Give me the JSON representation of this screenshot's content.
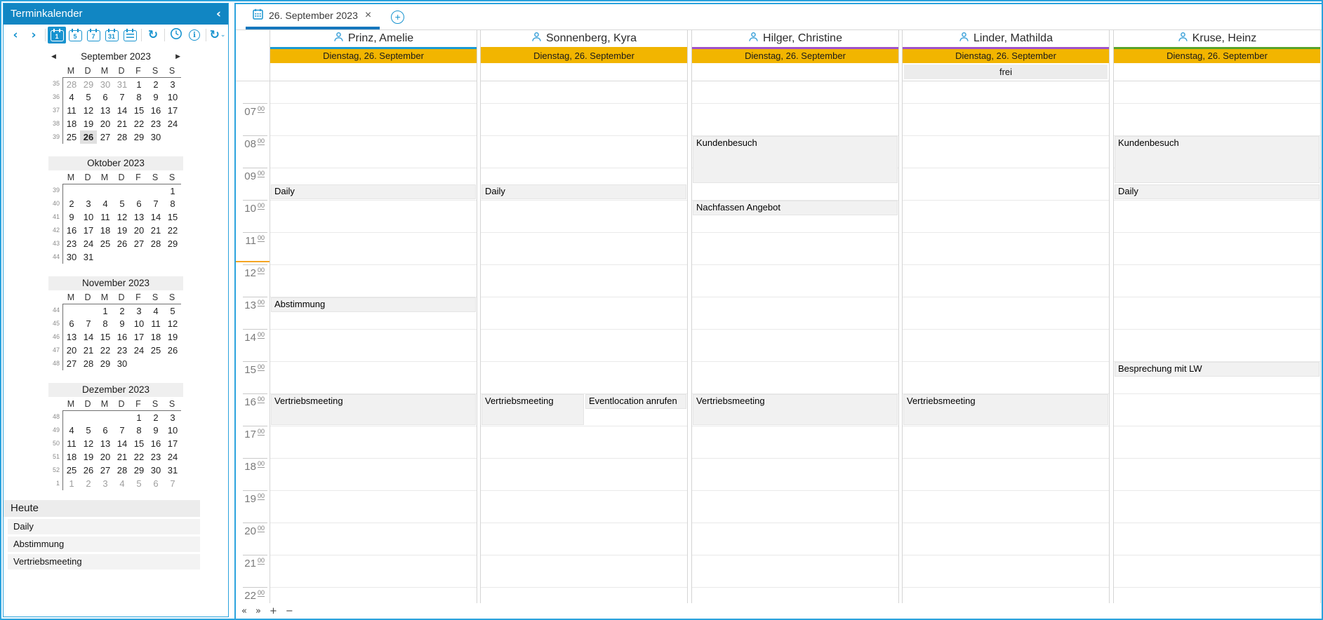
{
  "colors": {
    "accent_blue": "#1793cf",
    "titlebar_blue": "#1186c3",
    "panel_border_blue": "#2ba3dd",
    "date_bar_amber": "#f2b500",
    "current_time_line": "#f5a623",
    "event_fill": "#f1f1f1"
  },
  "sidebar": {
    "title": "Terminkalender",
    "collapse_glyph": "‹",
    "nav_prev_glyph": "◀",
    "nav_next_glyph": "▶",
    "week_day_headers": [
      "M",
      "D",
      "M",
      "D",
      "F",
      "S",
      "S"
    ],
    "toolbar": [
      {
        "name": "prev-period",
        "glyph": "‹"
      },
      {
        "name": "next-period",
        "glyph": "›"
      },
      {
        "type": "sep"
      },
      {
        "type": "cal",
        "name": "day-view",
        "label": "1",
        "selected": true
      },
      {
        "type": "cal",
        "name": "workweek-view",
        "label": "5"
      },
      {
        "type": "cal",
        "name": "week-view",
        "label": "7"
      },
      {
        "type": "cal",
        "name": "month-view",
        "label": "31"
      },
      {
        "type": "agenda",
        "name": "agenda-view"
      },
      {
        "type": "sep"
      },
      {
        "name": "refresh",
        "glyph": "↻"
      },
      {
        "type": "sep"
      },
      {
        "type": "clock",
        "name": "time-scale"
      },
      {
        "type": "info",
        "name": "info"
      },
      {
        "type": "sep"
      },
      {
        "name": "sync",
        "glyph": "↻",
        "dropdown": "⌄"
      }
    ],
    "months": [
      {
        "title": "September 2023",
        "nav": true,
        "gray": false,
        "weeks": [
          {
            "n": "35",
            "days": [
              "28m",
              "29m",
              "30m",
              "31m",
              "1",
              "2",
              "3"
            ]
          },
          {
            "n": "36",
            "days": [
              "4",
              "5",
              "6",
              "7",
              "8",
              "9",
              "10"
            ]
          },
          {
            "n": "37",
            "days": [
              "11",
              "12",
              "13",
              "14",
              "15",
              "16",
              "17"
            ]
          },
          {
            "n": "38",
            "days": [
              "18",
              "19",
              "20",
              "21",
              "22",
              "23",
              "24"
            ]
          },
          {
            "n": "39",
            "days": [
              "25",
              "26s",
              "27",
              "28",
              "29",
              "30",
              ""
            ]
          }
        ]
      },
      {
        "title": "Oktober 2023",
        "nav": false,
        "gray": true,
        "weeks": [
          {
            "n": "39",
            "days": [
              "",
              "",
              "",
              "",
              "",
              "",
              "1"
            ]
          },
          {
            "n": "40",
            "days": [
              "2",
              "3",
              "4",
              "5",
              "6",
              "7",
              "8"
            ]
          },
          {
            "n": "41",
            "days": [
              "9",
              "10",
              "11",
              "12",
              "13",
              "14",
              "15"
            ]
          },
          {
            "n": "42",
            "days": [
              "16",
              "17",
              "18",
              "19",
              "20",
              "21",
              "22"
            ]
          },
          {
            "n": "43",
            "days": [
              "23",
              "24",
              "25",
              "26",
              "27",
              "28",
              "29"
            ]
          },
          {
            "n": "44",
            "days": [
              "30",
              "31",
              "",
              "",
              "",
              "",
              ""
            ]
          }
        ]
      },
      {
        "title": "November 2023",
        "nav": false,
        "gray": true,
        "weeks": [
          {
            "n": "44",
            "days": [
              "",
              "",
              "1",
              "2",
              "3",
              "4",
              "5"
            ]
          },
          {
            "n": "45",
            "days": [
              "6",
              "7",
              "8",
              "9",
              "10",
              "11",
              "12"
            ]
          },
          {
            "n": "46",
            "days": [
              "13",
              "14",
              "15",
              "16",
              "17",
              "18",
              "19"
            ]
          },
          {
            "n": "47",
            "days": [
              "20",
              "21",
              "22",
              "23",
              "24",
              "25",
              "26"
            ]
          },
          {
            "n": "48",
            "days": [
              "27",
              "28",
              "29",
              "30",
              "",
              "",
              ""
            ]
          }
        ]
      },
      {
        "title": "Dezember 2023",
        "nav": false,
        "gray": true,
        "weeks": [
          {
            "n": "48",
            "days": [
              "",
              "",
              "",
              "",
              "1",
              "2",
              "3"
            ]
          },
          {
            "n": "49",
            "days": [
              "4",
              "5",
              "6",
              "7",
              "8",
              "9",
              "10"
            ]
          },
          {
            "n": "50",
            "days": [
              "11",
              "12",
              "13",
              "14",
              "15",
              "16",
              "17"
            ]
          },
          {
            "n": "51",
            "days": [
              "18",
              "19",
              "20",
              "21",
              "22",
              "23",
              "24"
            ]
          },
          {
            "n": "52",
            "days": [
              "25",
              "26",
              "27",
              "28",
              "29",
              "30",
              "31"
            ]
          },
          {
            "n": "1",
            "days": [
              "1m",
              "2m",
              "3m",
              "4m",
              "5m",
              "6m",
              "7m"
            ]
          }
        ]
      }
    ],
    "today": {
      "header": "Heute",
      "items": [
        "Daily",
        "Abstimmung",
        "Vertriebsmeeting"
      ]
    }
  },
  "main": {
    "tab": {
      "label": "26. September 2023",
      "close_glyph": "×",
      "add_glyph": "+"
    },
    "scheduler": {
      "hours_start": 7,
      "hours_end": 22,
      "minutes_label": "00",
      "date_label": "Dienstag, 26. September",
      "current_time_hour": 11.9,
      "columns": [
        {
          "name": "Prinz, Amelie",
          "color": "#1b9ad2",
          "allday": "",
          "events": [
            {
              "title": "Daily",
              "start": 9.5,
              "end": 10
            },
            {
              "title": "Abstimmung",
              "start": 13,
              "end": 13.5
            },
            {
              "title": "Vertriebsmeeting",
              "start": 16,
              "end": 17
            }
          ]
        },
        {
          "name": "Sonnenberg, Kyra",
          "color": "#f0b400",
          "allday": "",
          "events": [
            {
              "title": "Daily",
              "start": 9.5,
              "end": 10
            },
            {
              "title": "Vertriebsmeeting",
              "start": 16,
              "end": 17,
              "side": "left"
            },
            {
              "title": "Eventlocation anrufen",
              "start": 16,
              "end": 16.5,
              "side": "right"
            }
          ]
        },
        {
          "name": "Hilger, Christine",
          "color": "#a052c8",
          "allday": "",
          "events": [
            {
              "title": "Kundenbesuch",
              "start": 8,
              "end": 9.5
            },
            {
              "title": "Nachfassen Angebot",
              "start": 10,
              "end": 10.5
            },
            {
              "title": "Vertriebsmeeting",
              "start": 16,
              "end": 17
            }
          ]
        },
        {
          "name": "Linder, Mathilda",
          "color": "#a052c8",
          "allday": "frei",
          "events": [
            {
              "title": "Vertriebsmeeting",
              "start": 16,
              "end": 17
            }
          ]
        },
        {
          "name": "Kruse, Heinz",
          "color": "#58a32a",
          "allday": "",
          "events": [
            {
              "title": "Kundenbesuch",
              "start": 8,
              "end": 9.5
            },
            {
              "title": "Daily",
              "start": 9.5,
              "end": 10
            },
            {
              "title": "Besprechung mit LW",
              "start": 15,
              "end": 15.5
            }
          ]
        }
      ]
    },
    "bottom_controls": [
      "«",
      "»",
      "+",
      "−"
    ]
  }
}
